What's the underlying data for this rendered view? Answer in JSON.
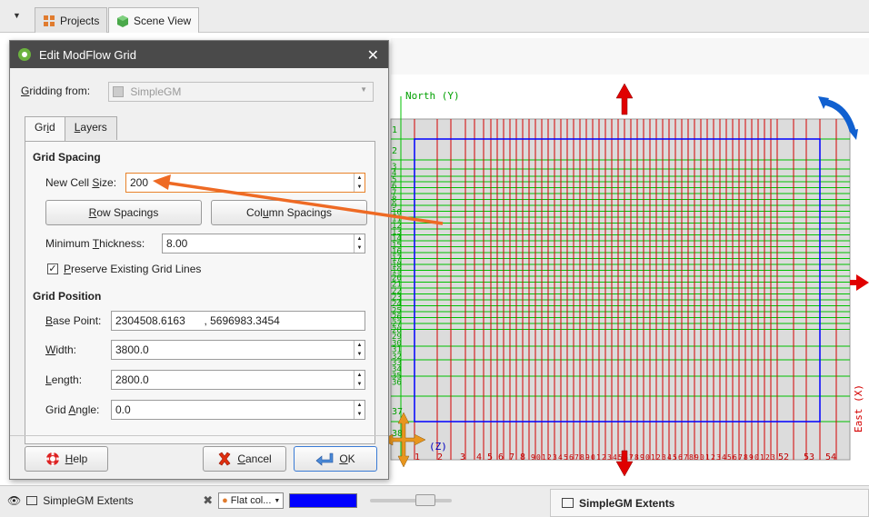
{
  "tabs": {
    "projects_label": "Projects",
    "scene_view_label": "Scene View"
  },
  "dialog": {
    "title": "Edit ModFlow Grid",
    "gridding_from_label": "Gridding from:",
    "gridding_from_value": "SimpleGM",
    "tab_grid": "Grid",
    "tab_layers": "Layers",
    "grid_spacing_title": "Grid Spacing",
    "new_cell_size_label": "New Cell Size:",
    "new_cell_size_value": "200",
    "row_spacings_label": "Row Spacings",
    "column_spacings_label": "Column Spacings",
    "min_thickness_label": "Minimum Thickness:",
    "min_thickness_value": "8.00",
    "preserve_label": "Preserve Existing Grid Lines",
    "preserve_checked": true,
    "grid_position_title": "Grid Position",
    "base_point_label": "Base Point:",
    "base_point_x": "2304508.6163",
    "base_point_y": ", 5696983.3454",
    "width_label": "Width:",
    "width_value": "3800.0",
    "length_label": "Length:",
    "length_value": "2800.0",
    "grid_angle_label": "Grid Angle:",
    "grid_angle_value": "0.0",
    "help_label": "Help",
    "cancel_label": "Cancel",
    "ok_label": "OK"
  },
  "scene": {
    "north_label": "North (Y)",
    "east_label": "East (X)",
    "z_label": "(Z)",
    "row_numbers": [
      "1",
      "2",
      "3",
      "4",
      "5",
      "6",
      "7",
      "8",
      "9",
      "10",
      "11",
      "12",
      "13",
      "14",
      "15",
      "16",
      "17",
      "18",
      "19",
      "20",
      "21",
      "22",
      "23",
      "24",
      "25",
      "26",
      "27",
      "28",
      "29",
      "30",
      "31",
      "32",
      "33",
      "34",
      "35",
      "36",
      "37",
      "38"
    ],
    "col_numbers_start": [
      "1",
      "2",
      "3",
      "4",
      "5",
      "6",
      "7",
      "8"
    ],
    "col_numbers_end": [
      "52",
      "53",
      "54"
    ],
    "grid_line_color": "#00c000",
    "col_line_color": "#d40000",
    "extent_color": "#0000ff"
  },
  "bottom": {
    "object_name": "SimpleGM Extents",
    "colour_mode": "Flat col...",
    "swatch_color": "#0000ff",
    "panel_title": "SimpleGM Extents"
  }
}
